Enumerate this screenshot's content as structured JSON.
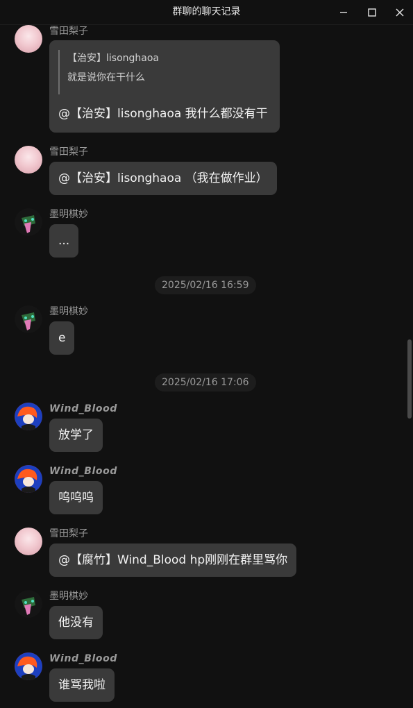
{
  "window": {
    "title": "群聊的聊天记录"
  },
  "messages": [
    {
      "sender": "雪田梨子",
      "quote_author": "【治安】lisonghaoa",
      "quote_text": "就是说你在干什么",
      "text": "@【治安】lisonghaoa 我什么都没有干"
    },
    {
      "sender": "雪田梨子",
      "text": "@【治安】lisonghaoa （我在做作业）"
    },
    {
      "sender": "墨明棋妙",
      "text": "..."
    },
    {
      "timestamp": "2025/02/16 16:59"
    },
    {
      "sender": "墨明棋妙",
      "text": "e"
    },
    {
      "timestamp": "2025/02/16 17:06"
    },
    {
      "sender": "Wind_Blood",
      "text": "放学了"
    },
    {
      "sender": "Wind_Blood",
      "text": "呜呜呜"
    },
    {
      "sender": "雪田梨子",
      "text": "@【腐竹】Wind_Blood hp刚刚在群里骂你"
    },
    {
      "sender": "墨明棋妙",
      "text": "他没有"
    },
    {
      "sender": "Wind_Blood",
      "text": "谁骂我啦"
    }
  ],
  "icons": {
    "minimize": "minimize-icon",
    "maximize": "maximize-icon",
    "close": "close-icon"
  },
  "colors": {
    "background": "#111111",
    "bubble": "#3a3a3a",
    "timestamp_bg": "#1d1d1d",
    "name": "#9a9a9a"
  }
}
